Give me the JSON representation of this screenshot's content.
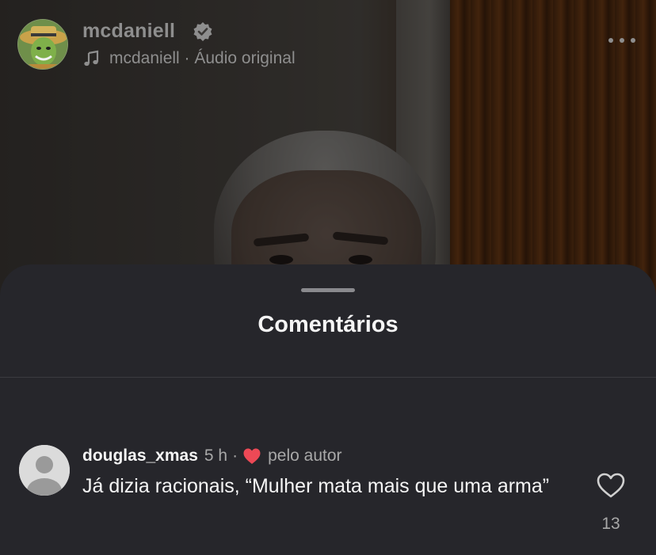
{
  "header": {
    "username": "mcdaniell",
    "verified_icon": "verified-badge-icon",
    "audio_label": "mcdaniell · Áudio original",
    "music_icon": "music-note-icon",
    "more_icon": "more-horizontal-icon"
  },
  "sheet": {
    "title": "Comentários"
  },
  "comment": {
    "username": "douglas_xmas",
    "time": "5 h",
    "separator": "·",
    "liked_by_author_label": "pelo autor",
    "text": "Já dizia racionais, “Mulher mata mais que uma arma”",
    "like_count": "13",
    "heart_color": "#ed4956"
  },
  "colors": {
    "sheet_bg": "#26262b",
    "text_primary": "#f5f5f5",
    "text_secondary": "#a8a8a8"
  }
}
